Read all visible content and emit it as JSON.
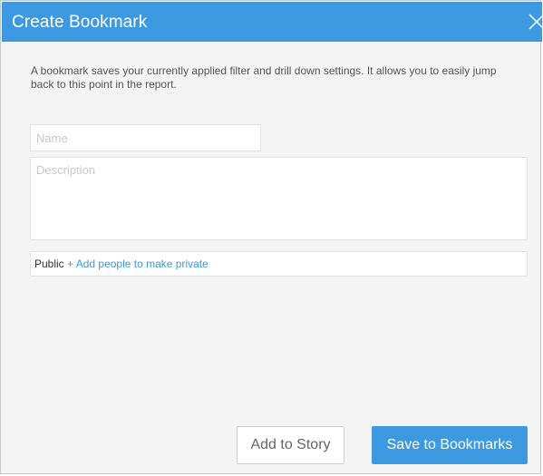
{
  "dialog": {
    "title": "Create Bookmark",
    "close_icon": "close-icon",
    "description": "A bookmark saves your currently applied filter and drill down settings. It allows you to easily jump back to this point in the report.",
    "name_placeholder": "Name",
    "description_placeholder": "Description",
    "access": {
      "visibility": "Public",
      "separator": "+",
      "add_people_label": "Add people to make private"
    },
    "buttons": {
      "add_to_story": "Add to Story",
      "save_to_bookmarks": "Save to Bookmarks"
    }
  },
  "colors": {
    "accent": "#3d99e0",
    "background": "#f4f4f4"
  }
}
